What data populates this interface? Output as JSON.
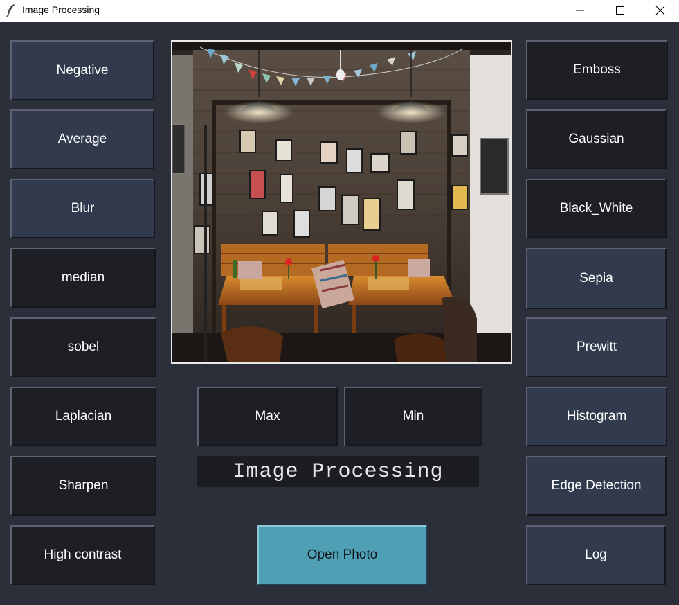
{
  "window": {
    "title": "Image Processing",
    "icon": "feather-icon"
  },
  "left_buttons": [
    "Negative",
    "Average",
    "Blur",
    "median",
    "sobel",
    "Laplacian",
    "Sharpen",
    "High contrast"
  ],
  "right_buttons": [
    "Emboss",
    "Gaussian",
    "Black_White",
    "Sepia",
    "Prewitt",
    "Histogram",
    "Edge Detection",
    "Log"
  ],
  "center": {
    "max_label": "Max",
    "min_label": "Min",
    "app_label": "Image Processing",
    "open_label": "Open Photo"
  },
  "colors": {
    "background": "#2b2f3a",
    "button_blue": "#323b4d",
    "button_dark": "#1d1f24",
    "accent_teal": "#4fa0b4"
  }
}
